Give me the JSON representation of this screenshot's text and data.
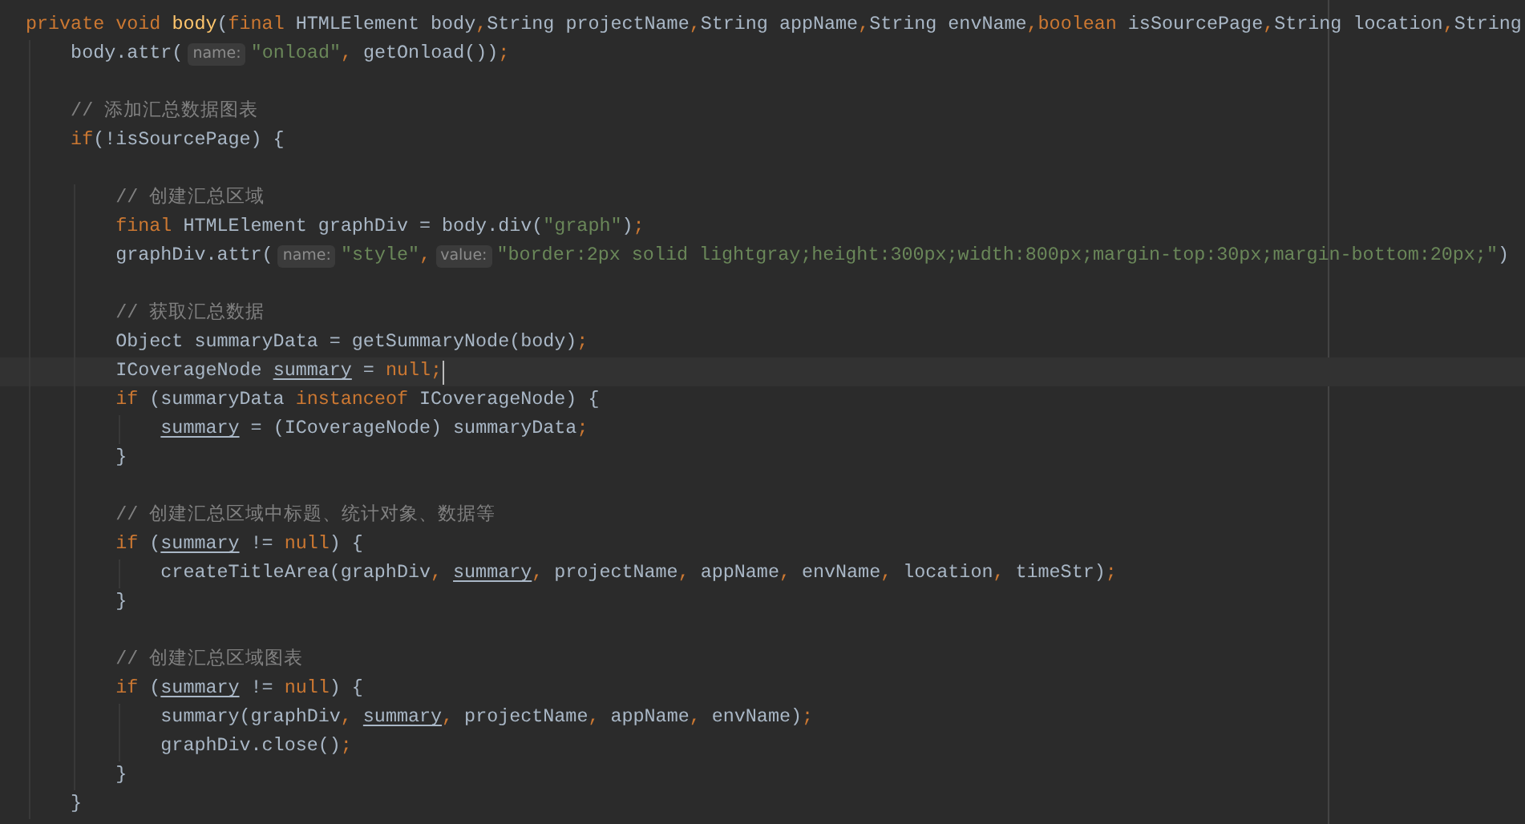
{
  "editor": {
    "lines": [
      {
        "current": false,
        "segments": [
          {
            "kind": "code",
            "tokens": [
              {
                "t": "private void ",
                "kind": "keyword"
              },
              {
                "t": "body",
                "kind": "method"
              },
              {
                "t": "(",
                "kind": "plain"
              },
              {
                "t": "final ",
                "kind": "keyword"
              },
              {
                "t": "HTMLElement body",
                "kind": "plain"
              },
              {
                "t": ",",
                "kind": "keyword"
              },
              {
                "t": "String projectName",
                "kind": "plain"
              },
              {
                "t": ",",
                "kind": "keyword"
              },
              {
                "t": "String appName",
                "kind": "plain"
              },
              {
                "t": ",",
                "kind": "keyword"
              },
              {
                "t": "String envName",
                "kind": "plain"
              },
              {
                "t": ",",
                "kind": "keyword"
              },
              {
                "t": "boolean",
                "kind": "keyword"
              },
              {
                "t": " isSourcePage",
                "kind": "plain"
              },
              {
                "t": ",",
                "kind": "keyword"
              },
              {
                "t": "String location",
                "kind": "plain"
              },
              {
                "t": ",",
                "kind": "keyword"
              },
              {
                "t": "String",
                "kind": "plain"
              }
            ]
          }
        ]
      },
      {
        "current": false,
        "segments": [
          {
            "kind": "code",
            "tokens": [
              {
                "t": "    body.attr(",
                "kind": "plain"
              }
            ]
          },
          {
            "kind": "hint",
            "text": "name:"
          },
          {
            "kind": "code",
            "tokens": [
              {
                "t": "\"onload\"",
                "kind": "string"
              },
              {
                "t": ",",
                "kind": "keyword"
              },
              {
                "t": " getOnload())",
                "kind": "plain"
              },
              {
                "t": ";",
                "kind": "keyword"
              }
            ]
          }
        ]
      },
      {
        "current": false
      },
      {
        "current": false,
        "segments": [
          {
            "kind": "code",
            "tokens": [
              {
                "t": "    // 添加汇总数据图表",
                "kind": "comment"
              }
            ]
          }
        ]
      },
      {
        "current": false,
        "segments": [
          {
            "kind": "code",
            "tokens": [
              {
                "t": "    if",
                "kind": "keyword"
              },
              {
                "t": "(!isSourcePage) {",
                "kind": "plain"
              }
            ]
          }
        ]
      },
      {
        "current": false
      },
      {
        "current": false,
        "segments": [
          {
            "kind": "code",
            "tokens": [
              {
                "t": "        // 创建汇总区域",
                "kind": "comment"
              }
            ]
          }
        ]
      },
      {
        "current": false,
        "segments": [
          {
            "kind": "code",
            "tokens": [
              {
                "t": "        final ",
                "kind": "keyword"
              },
              {
                "t": "HTMLElement graphDiv = body.div(",
                "kind": "plain"
              },
              {
                "t": "\"graph\"",
                "kind": "string"
              },
              {
                "t": ")",
                "kind": "plain"
              },
              {
                "t": ";",
                "kind": "keyword"
              }
            ]
          }
        ]
      },
      {
        "current": false,
        "segments": [
          {
            "kind": "code",
            "tokens": [
              {
                "t": "        graphDiv.attr(",
                "kind": "plain"
              }
            ]
          },
          {
            "kind": "hint",
            "text": "name:"
          },
          {
            "kind": "code",
            "tokens": [
              {
                "t": "\"style\"",
                "kind": "string"
              },
              {
                "t": ",",
                "kind": "keyword"
              }
            ]
          },
          {
            "kind": "hint",
            "text": "value:"
          },
          {
            "kind": "code",
            "tokens": [
              {
                "t": "\"border:2px solid lightgray;height:300px;width:800px;margin-top:30px;margin-bottom:20px;\"",
                "kind": "string"
              },
              {
                "t": ")",
                "kind": "plain"
              }
            ]
          }
        ]
      },
      {
        "current": false
      },
      {
        "current": false,
        "segments": [
          {
            "kind": "code",
            "tokens": [
              {
                "t": "        // 获取汇总数据",
                "kind": "comment"
              }
            ]
          }
        ]
      },
      {
        "current": false,
        "segments": [
          {
            "kind": "code",
            "tokens": [
              {
                "t": "        Object summaryData = getSummaryNode(body)",
                "kind": "plain"
              },
              {
                "t": ";",
                "kind": "keyword"
              }
            ]
          }
        ]
      },
      {
        "current": true,
        "segments": [
          {
            "kind": "code",
            "tokens": [
              {
                "t": "        ICoverageNode ",
                "kind": "plain"
              },
              {
                "t": "summary",
                "kind": "field"
              },
              {
                "t": " = ",
                "kind": "plain"
              },
              {
                "t": "null;",
                "kind": "keyword"
              }
            ]
          }
        ]
      },
      {
        "current": false,
        "segments": [
          {
            "kind": "code",
            "tokens": [
              {
                "t": "        if",
                "kind": "keyword"
              },
              {
                "t": " (summaryData ",
                "kind": "plain"
              },
              {
                "t": "instanceof",
                "kind": "keyword"
              },
              {
                "t": " ICoverageNode) {",
                "kind": "plain"
              }
            ]
          }
        ]
      },
      {
        "current": false,
        "segments": [
          {
            "kind": "code",
            "tokens": [
              {
                "t": "            summary",
                "kind": "field"
              },
              {
                "t": " = (ICoverageNode) summaryData",
                "kind": "plain"
              },
              {
                "t": ";",
                "kind": "keyword"
              }
            ]
          }
        ]
      },
      {
        "current": false,
        "segments": [
          {
            "kind": "code",
            "tokens": [
              {
                "t": "        }",
                "kind": "plain"
              }
            ]
          }
        ]
      },
      {
        "current": false
      },
      {
        "current": false,
        "segments": [
          {
            "kind": "code",
            "tokens": [
              {
                "t": "        // 创建汇总区域中标题、统计对象、数据等",
                "kind": "comment"
              }
            ]
          }
        ]
      },
      {
        "current": false,
        "segments": [
          {
            "kind": "code",
            "tokens": [
              {
                "t": "        if",
                "kind": "keyword"
              },
              {
                "t": " (",
                "kind": "plain"
              },
              {
                "t": "summary",
                "kind": "field"
              },
              {
                "t": " != ",
                "kind": "plain"
              },
              {
                "t": "null",
                "kind": "keyword"
              },
              {
                "t": ") {",
                "kind": "plain"
              }
            ]
          }
        ]
      },
      {
        "current": false,
        "segments": [
          {
            "kind": "code",
            "tokens": [
              {
                "t": "            createTitleArea(graphDiv",
                "kind": "plain"
              },
              {
                "t": ",",
                "kind": "keyword"
              },
              {
                "t": " summary",
                "kind": "field"
              },
              {
                "t": ",",
                "kind": "keyword"
              },
              {
                "t": " projectName",
                "kind": "plain"
              },
              {
                "t": ",",
                "kind": "keyword"
              },
              {
                "t": " appName",
                "kind": "plain"
              },
              {
                "t": ",",
                "kind": "keyword"
              },
              {
                "t": " envName",
                "kind": "plain"
              },
              {
                "t": ",",
                "kind": "keyword"
              },
              {
                "t": " location",
                "kind": "plain"
              },
              {
                "t": ",",
                "kind": "keyword"
              },
              {
                "t": " timeStr)",
                "kind": "plain"
              },
              {
                "t": ";",
                "kind": "keyword"
              }
            ]
          }
        ]
      },
      {
        "current": false,
        "segments": [
          {
            "kind": "code",
            "tokens": [
              {
                "t": "        }",
                "kind": "plain"
              }
            ]
          }
        ]
      },
      {
        "current": false
      },
      {
        "current": false,
        "segments": [
          {
            "kind": "code",
            "tokens": [
              {
                "t": "        // 创建汇总区域图表",
                "kind": "comment"
              }
            ]
          }
        ]
      },
      {
        "current": false,
        "segments": [
          {
            "kind": "code",
            "tokens": [
              {
                "t": "        if",
                "kind": "keyword"
              },
              {
                "t": " (",
                "kind": "plain"
              },
              {
                "t": "summary",
                "kind": "field"
              },
              {
                "t": " != ",
                "kind": "plain"
              },
              {
                "t": "null",
                "kind": "keyword"
              },
              {
                "t": ") {",
                "kind": "plain"
              }
            ]
          }
        ]
      },
      {
        "current": false,
        "segments": [
          {
            "kind": "code",
            "tokens": [
              {
                "t": "            summary(graphDiv",
                "kind": "plain"
              },
              {
                "t": ",",
                "kind": "keyword"
              },
              {
                "t": " summary",
                "kind": "field"
              },
              {
                "t": ",",
                "kind": "keyword"
              },
              {
                "t": " projectName",
                "kind": "plain"
              },
              {
                "t": ",",
                "kind": "keyword"
              },
              {
                "t": " appName",
                "kind": "plain"
              },
              {
                "t": ",",
                "kind": "keyword"
              },
              {
                "t": " envName)",
                "kind": "plain"
              },
              {
                "t": ";",
                "kind": "keyword"
              }
            ]
          }
        ]
      },
      {
        "current": false,
        "segments": [
          {
            "kind": "code",
            "tokens": [
              {
                "t": "            graphDiv.close()",
                "kind": "plain"
              },
              {
                "t": ";",
                "kind": "keyword"
              }
            ]
          }
        ]
      },
      {
        "current": false,
        "segments": [
          {
            "kind": "code",
            "tokens": [
              {
                "t": "        }",
                "kind": "plain"
              }
            ]
          }
        ]
      },
      {
        "current": false,
        "segments": [
          {
            "kind": "code",
            "tokens": [
              {
                "t": "    }",
                "kind": "plain"
              }
            ]
          }
        ]
      }
    ]
  }
}
